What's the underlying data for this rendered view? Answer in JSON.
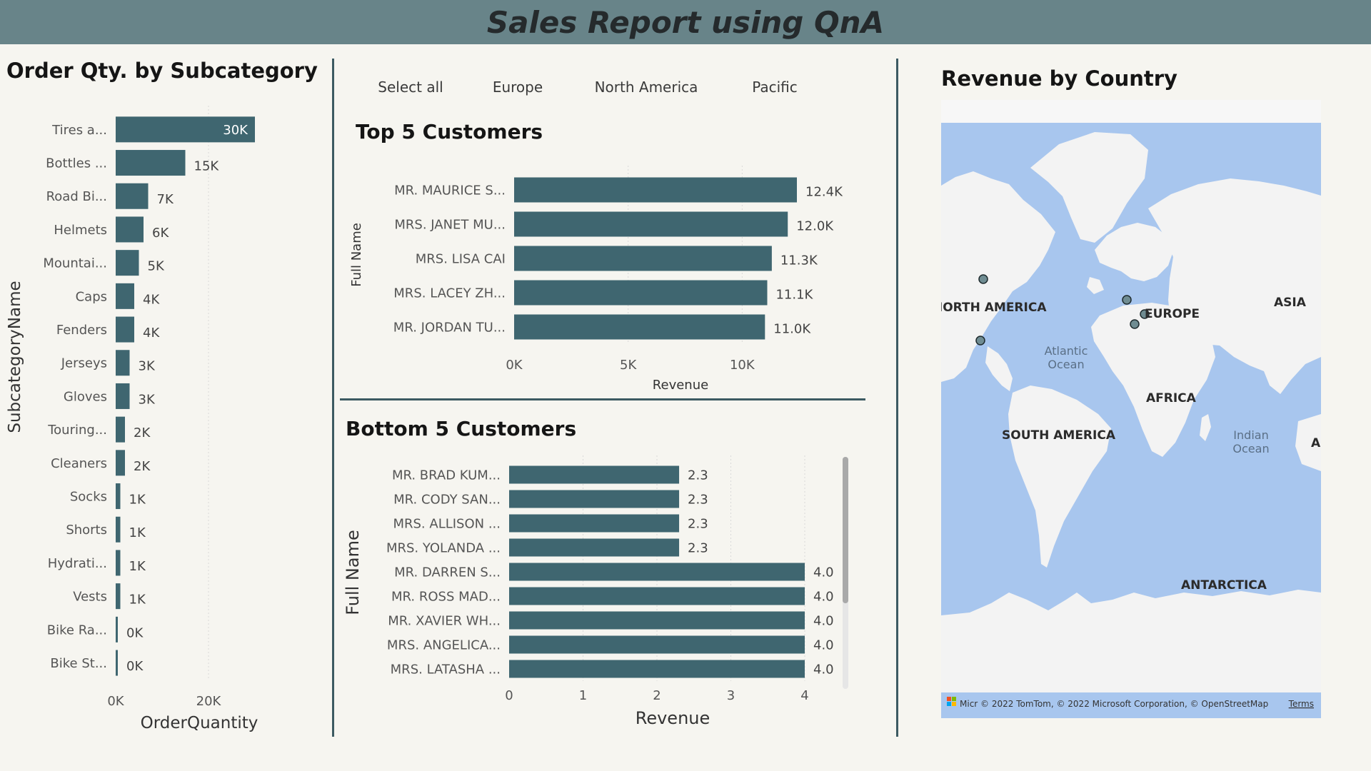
{
  "header": {
    "title": "Sales Report using QnA"
  },
  "slicer": {
    "items": [
      "Select all",
      "Europe",
      "North America",
      "Pacific"
    ]
  },
  "colors": {
    "header_bg": "#688489",
    "bar": "#3F6670",
    "ocean": "#A8C6EE",
    "land": "#F3F3F3",
    "divider": "#3C5A62",
    "background": "#F6F5F0"
  },
  "chart_data": [
    {
      "type": "bar",
      "orientation": "horizontal",
      "title": "Order Qty. by Subcategory",
      "xlabel": "OrderQuantity",
      "ylabel": "SubcategoryName",
      "categories": [
        "Tires a...",
        "Bottles ...",
        "Road Bi...",
        "Helmets",
        "Mountai...",
        "Caps",
        "Fenders",
        "Jerseys",
        "Gloves",
        "Touring...",
        "Cleaners",
        "Socks",
        "Shorts",
        "Hydrati...",
        "Vests",
        "Bike Ra...",
        "Bike St..."
      ],
      "values": [
        30000,
        15000,
        7000,
        6000,
        5000,
        4000,
        4000,
        3000,
        3000,
        2000,
        2000,
        1000,
        1000,
        1000,
        1000,
        300,
        200
      ],
      "data_labels": [
        "30K",
        "15K",
        "7K",
        "6K",
        "5K",
        "4K",
        "4K",
        "3K",
        "3K",
        "2K",
        "2K",
        "1K",
        "1K",
        "1K",
        "1K",
        "0K",
        "0K"
      ],
      "xticks": [
        "0K",
        "20K"
      ],
      "xlim": [
        0,
        30000
      ]
    },
    {
      "type": "bar",
      "orientation": "horizontal",
      "title": "Top 5 Customers",
      "xlabel": "Revenue",
      "ylabel": "Full Name",
      "categories": [
        "MR. MAURICE S...",
        "MRS. JANET MU...",
        "MRS. LISA CAI",
        "MRS. LACEY ZH...",
        "MR. JORDAN TU..."
      ],
      "values": [
        12400,
        12000,
        11300,
        11100,
        11000
      ],
      "data_labels": [
        "12.4K",
        "12.0K",
        "11.3K",
        "11.1K",
        "11.0K"
      ],
      "xticks": [
        "0K",
        "5K",
        "10K"
      ],
      "xlim": [
        0,
        12400
      ]
    },
    {
      "type": "bar",
      "orientation": "horizontal",
      "title": "Bottom 5 Customers",
      "xlabel": "Revenue",
      "ylabel": "Full Name",
      "categories": [
        "MR. BRAD KUM...",
        "MR. CODY SAN...",
        "MRS. ALLISON ...",
        "MRS. YOLANDA ...",
        "MR. DARREN S...",
        "MR. ROSS MAD...",
        "MR. XAVIER WH...",
        "MRS. ANGELICA...",
        "MRS. LATASHA ..."
      ],
      "values": [
        2.3,
        2.3,
        2.3,
        2.3,
        4.0,
        4.0,
        4.0,
        4.0,
        4.0
      ],
      "data_labels": [
        "2.3",
        "2.3",
        "2.3",
        "2.3",
        "4.0",
        "4.0",
        "4.0",
        "4.0",
        "4.0"
      ],
      "xticks": [
        "0",
        "1",
        "2",
        "3",
        "4"
      ],
      "xlim": [
        0,
        4
      ]
    }
  ],
  "map": {
    "title": "Revenue by Country",
    "labels": {
      "north_america": "NORTH AMERICA",
      "europe": "EUROPE",
      "asia": "ASIA",
      "africa": "AFRICA",
      "south_america": "SOUTH AMERICA",
      "antarctica": "ANTARCTICA",
      "atlantic": [
        "Atlantic",
        "Ocean"
      ],
      "indian": [
        "Indian",
        "Ocean"
      ],
      "australia_clip": "AI"
    },
    "attribution": "Micr © 2022 TomTom, © 2022 Microsoft Corporation, © OpenStreetMap",
    "terms": "Terms"
  }
}
